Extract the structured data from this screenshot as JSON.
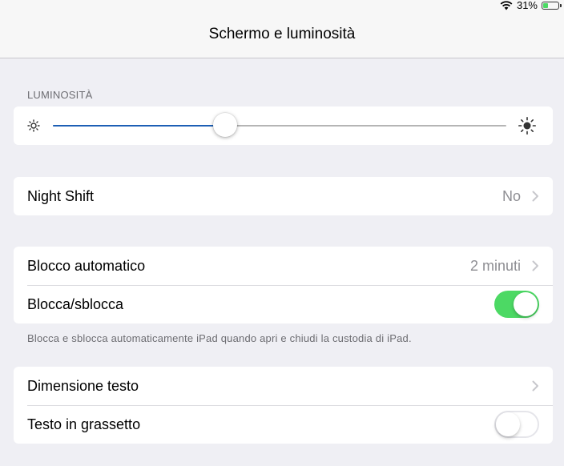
{
  "status_bar": {
    "battery_text": "31%",
    "battery_level": 0.31,
    "icons": [
      "wifi-icon",
      "battery-icon"
    ]
  },
  "nav": {
    "title": "Schermo e luminosità"
  },
  "brightness": {
    "header": "LUMINOSITÀ",
    "level": 0.38,
    "accent_color": "#1d5fb5"
  },
  "night_shift": {
    "label": "Night Shift",
    "value": "No"
  },
  "auto_lock": {
    "label": "Blocco automatico",
    "value": "2 minuti"
  },
  "lock_unlock": {
    "label": "Blocca/sblocca",
    "on": true
  },
  "lock_footer": "Blocca e sblocca automaticamente iPad quando apri e chiudi la custodia di iPad.",
  "text_size": {
    "label": "Dimensione testo"
  },
  "bold_text": {
    "label": "Testo in grassetto",
    "on": false
  },
  "colors": {
    "toggle_on": "#4cd964",
    "background": "#efeff4"
  }
}
